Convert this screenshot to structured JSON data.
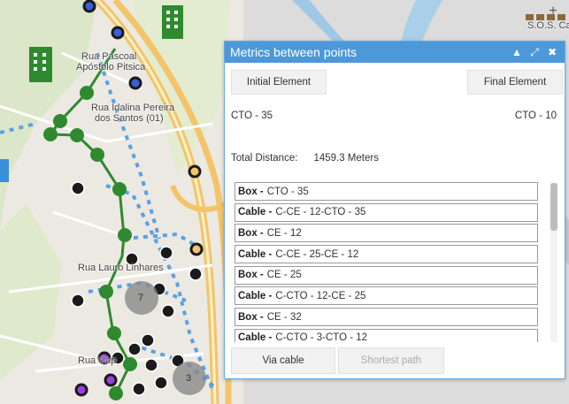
{
  "map": {
    "labels": {
      "street1": "Rua Pascoal",
      "street1b": "Apóstolo Pitsica",
      "street2": "Rua Idalina Pereira",
      "street2b": "dos Santos (01)",
      "street3": "Rua Lauro Linhares",
      "street4": "Rua Cap",
      "poi": "S.O.S. Care"
    },
    "cluster_counts": [
      "7",
      "3"
    ],
    "zoom_symbol": "+",
    "colors": {
      "route": "#2f8a2f",
      "dashed": "#5aa0e6",
      "node_outline": "#1a1a1a"
    }
  },
  "dialog": {
    "title": "Metrics between points",
    "icons": [
      "collapse-icon",
      "expand-icon",
      "close-icon"
    ],
    "tabs": {
      "initial": "Initial Element",
      "final": "Final Element"
    },
    "initial_value": "CTO - 35",
    "final_value": "CTO - 10",
    "distance_label": "Total Distance:",
    "distance_value": "1459.3 Meters",
    "items": [
      {
        "kind": "Box - ",
        "text": "CTO - 35"
      },
      {
        "kind": "Cable - ",
        "text": "C-CE - 12-CTO - 35"
      },
      {
        "kind": "Box - ",
        "text": "CE - 12"
      },
      {
        "kind": "Cable - ",
        "text": "C-CE - 25-CE - 12"
      },
      {
        "kind": "Box - ",
        "text": "CE - 25"
      },
      {
        "kind": "Cable - ",
        "text": "C-CTO - 12-CE - 25"
      },
      {
        "kind": "Box - ",
        "text": "CE - 32"
      },
      {
        "kind": "Cable - ",
        "text": "C-CTO - 3-CTO - 12"
      }
    ],
    "buttons": {
      "via_cable": "Via cable",
      "shortest_path": "Shortest path"
    }
  }
}
